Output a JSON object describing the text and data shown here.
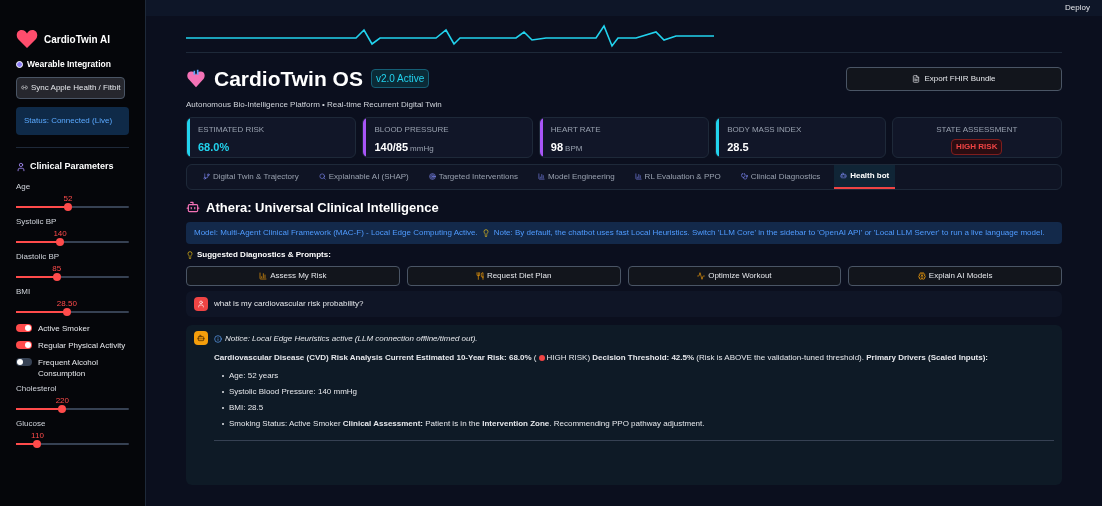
{
  "toolbar": {
    "deploy": "Deploy"
  },
  "sidebar": {
    "brand": "CardioTwin AI",
    "wearable_title": "Wearable Integration",
    "sync_button": "Sync Apple Health / Fitbit",
    "status": "Status: Connected (Live)",
    "params_title": "Clinical Parameters",
    "controls": [
      {
        "kind": "slider",
        "label": "Age",
        "reading": "52",
        "level": 0.46
      },
      {
        "kind": "slider",
        "label": "Systolic BP",
        "reading": "140",
        "level": 0.39
      },
      {
        "kind": "slider",
        "label": "Diastolic BP",
        "reading": "85",
        "level": 0.36
      },
      {
        "kind": "slider",
        "label": "BMI",
        "reading": "28.50",
        "level": 0.45
      },
      {
        "kind": "toggle",
        "label": "Active Smoker",
        "on": true
      },
      {
        "kind": "toggle",
        "label": "Regular Physical Activity",
        "on": true
      },
      {
        "kind": "toggle",
        "label": "Frequent Alcohol Consumption",
        "on": false
      },
      {
        "kind": "slider",
        "label": "Cholesterol",
        "reading": "220",
        "level": 0.41
      },
      {
        "kind": "slider",
        "label": "Glucose",
        "reading": "110",
        "level": 0.19
      }
    ]
  },
  "header": {
    "title": "CardioTwin OS",
    "badge": "v2.0 Active",
    "subtitle": "Autonomous Bio-Intelligence Platform • Real-time Recurrent Digital Twin",
    "export_button": "Export FHIR Bundle"
  },
  "metrics": [
    {
      "label": "ESTIMATED RISK",
      "value": "68.0%",
      "color": "#22d3ee"
    },
    {
      "label": "BLOOD PRESSURE",
      "value": "140/85",
      "unit": "mmHg",
      "color": "#a855f7"
    },
    {
      "label": "HEART RATE",
      "value": "98",
      "unit": "BPM",
      "color": "#a855f7"
    },
    {
      "label": "BODY MASS INDEX",
      "value": "28.5",
      "color": "#22d3ee"
    }
  ],
  "assessment": {
    "label": "STATE ASSESSMENT",
    "badge": "HIGH RISK"
  },
  "tabs": [
    {
      "label": "Digital Twin & Trajectory",
      "selected": false
    },
    {
      "label": "Explainable AI (SHAP)",
      "selected": false
    },
    {
      "label": "Targeted Interventions",
      "selected": false
    },
    {
      "label": "Model Engineering",
      "selected": false
    },
    {
      "label": "RL Evaluation & PPO",
      "selected": false
    },
    {
      "label": "Clinical Diagnostics",
      "selected": false
    },
    {
      "label": "Health bot",
      "selected": true
    }
  ],
  "chat": {
    "title": "Athera: Universal Clinical Intelligence",
    "info": "Model: Multi-Agent Clinical Framework (MAC-F) - Local Edge Computing Active.",
    "info_note": "Note: By default, the chatbot uses fast Local Heuristics. Switch 'LLM Core' in the sidebar to 'OpenAI API' or 'Local LLM Server' to run a live language model.",
    "prompts_title": "Suggested Diagnostics & Prompts:",
    "prompts": [
      "Assess My Risk",
      "Request Diet Plan",
      "Optimize Workout",
      "Explain AI Models"
    ],
    "user_message": "what is my cardiovascular risk probability?",
    "notice": "Notice: Local Edge Heuristics active (LLM connection offline/timed out).",
    "analysis_before": "**Cardiovascular Disease (CVD) Risk Analysis Current Estimated 10-Year Risk: 68.0%** (",
    "analysis_after": "HIGH RISK) **Decision Threshold: 42.5%** (Risk is ABOVE the validation-tuned threshold). **Primary Drivers (Scaled Inputs):**",
    "bullets": [
      "Age: 52 years",
      "Systolic Blood Pressure: 140 mmHg",
      "BMI: 28.5",
      "Smoking Status: Active Smoker **Clinical Assessment:** Patient is in the **Intervention Zone**. Recommending PPO pathway adjustment."
    ]
  }
}
